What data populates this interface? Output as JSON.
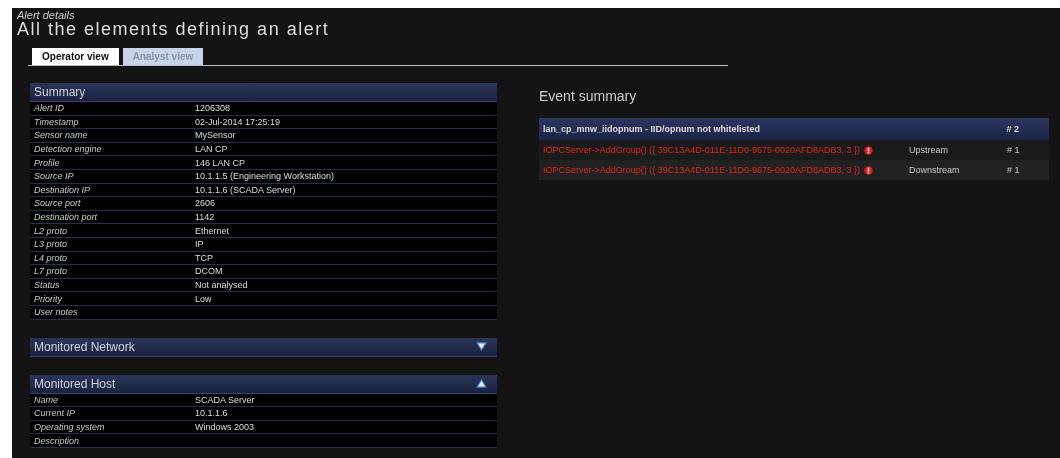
{
  "header": {
    "breadcrumb": "Alert details",
    "title": "All the elements defining an alert"
  },
  "tabs": [
    {
      "label": "Operator view",
      "selected": true
    },
    {
      "label": "Analyst view",
      "selected": false
    }
  ],
  "sections": [
    {
      "title": "Summary",
      "expanded": true,
      "collapsible": false,
      "rows": [
        {
          "label": "Alert ID",
          "value": "1206308"
        },
        {
          "label": "Timestamp",
          "value": "02-Jul-2014 17:25:19"
        },
        {
          "label": "Sensor name",
          "value": "MySensor"
        },
        {
          "label": "Detection engine",
          "value": "LAN CP"
        },
        {
          "label": "Profile",
          "value": "146 LAN CP"
        },
        {
          "label": "Source IP",
          "value": "10.1.1.5 (Engineering Workstation)"
        },
        {
          "label": "Destination IP",
          "value": "10.1.1.6 (SCADA Server)"
        },
        {
          "label": "Source port",
          "value": "2606"
        },
        {
          "label": "Destination port",
          "value": "1142"
        },
        {
          "label": "L2 proto",
          "value": "Ethernet"
        },
        {
          "label": "L3 proto",
          "value": "IP"
        },
        {
          "label": "L4 proto",
          "value": "TCP"
        },
        {
          "label": "L7 proto",
          "value": "DCOM"
        },
        {
          "label": "Status",
          "value": "Not analysed"
        },
        {
          "label": "Priority",
          "value": "Low"
        },
        {
          "label": "User notes"
        }
      ]
    },
    {
      "title": "Monitored Network",
      "expanded": false,
      "collapsible": true
    },
    {
      "title": "Monitored Host",
      "expanded": true,
      "collapsible": true,
      "rows": [
        {
          "label": "Name",
          "value": "SCADA Server"
        },
        {
          "label": "Current IP",
          "value": "10.1.1.6"
        },
        {
          "label": "Operating system",
          "value": "Windows 2003"
        },
        {
          "label": "Description"
        }
      ]
    }
  ],
  "event_summary": {
    "title": "Event summary",
    "header": {
      "name": "lan_cp_mnw_iidopnum - IID/opnum not whitelisted",
      "count": "# 2"
    },
    "rows": [
      {
        "event": "IOPCServer->AddGroup() ({ 39C13A4D-011E-11D0-9675-0020AFD8ADB3, 3 })",
        "direction": "Upstream",
        "count": "# 1"
      },
      {
        "event": "IOPCServer->AddGroup() ({ 39C13A4D-011E-11D0-9675-0020AFD8ADB3, 3 })",
        "direction": "Downstream",
        "count": "# 1"
      }
    ]
  }
}
